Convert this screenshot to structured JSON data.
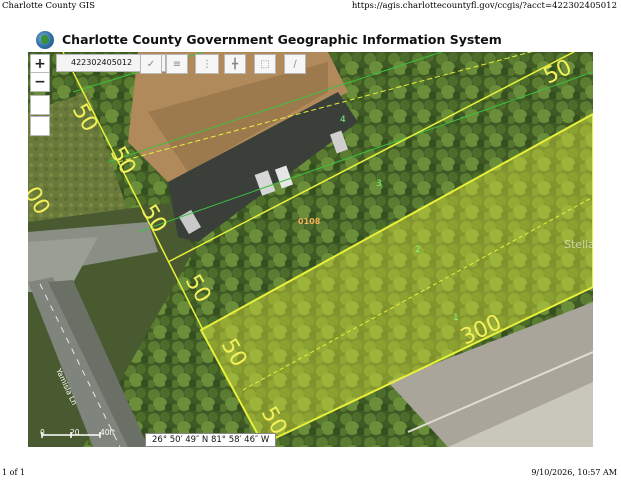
{
  "print": {
    "header_left": "Charlotte County GIS",
    "header_right": "https://agis.charlottecountyfl.gov/ccgis/?acct=422302405012",
    "footer_left": "1 of 1",
    "footer_right": "9/10/2026, 10:57 AM"
  },
  "app": {
    "title": "Charlotte County Government Geographic Information System",
    "logo_icon": "county-seal-icon"
  },
  "toolbar": {
    "zoom_in_label": "+",
    "zoom_out_label": "−",
    "search_value": "422302405012",
    "icons": [
      "layers-icon",
      "list-icon",
      "info-icon",
      "crosshair-icon",
      "select-box-icon",
      "blank-icon",
      "measure-icon"
    ]
  },
  "map": {
    "parcel_label": "0108",
    "lot_numbers": [
      "4",
      "3",
      "2",
      "1"
    ],
    "dimensions": [
      "50",
      "50",
      "50",
      "50",
      "50",
      "300",
      "50",
      "50",
      "50",
      "00"
    ],
    "road_label": "Yamisla Ln",
    "scale_labels": [
      "0",
      "20",
      "40ft"
    ],
    "coordinates": "26° 50′ 49″ N 81° 58′ 46″ W",
    "watermark": "Stellar MLS",
    "colors": {
      "parcel_outline": "#e8f03a",
      "lot_lines": "#3fbf3f",
      "highlight_fill": "#d9e33a"
    }
  }
}
